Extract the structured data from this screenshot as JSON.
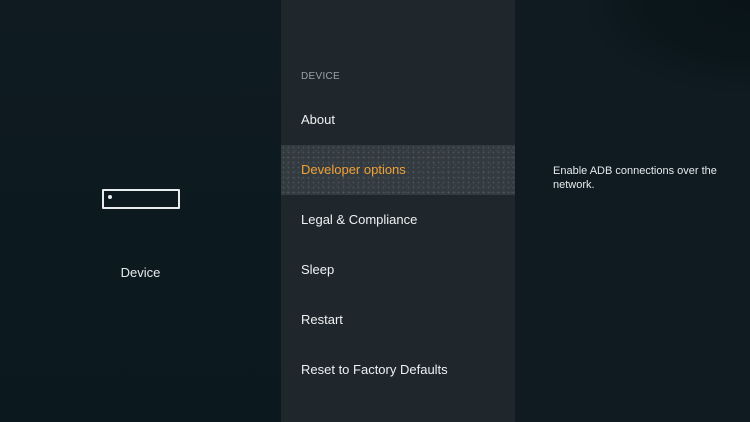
{
  "left_panel": {
    "device_label": "Device",
    "icon": "fire-tv-device-icon"
  },
  "menu": {
    "section_header": "DEVICE",
    "selected_index": 1,
    "items": [
      {
        "label": "About"
      },
      {
        "label": "Developer options"
      },
      {
        "label": "Legal & Compliance"
      },
      {
        "label": "Sleep"
      },
      {
        "label": "Restart"
      },
      {
        "label": "Reset to Factory Defaults"
      }
    ]
  },
  "description": {
    "text": "Enable ADB connections over the network."
  },
  "colors": {
    "accent": "#f0a035",
    "menu_background": "#1f272c",
    "side_background": "#0f1b21",
    "text": "#eef1f2"
  }
}
